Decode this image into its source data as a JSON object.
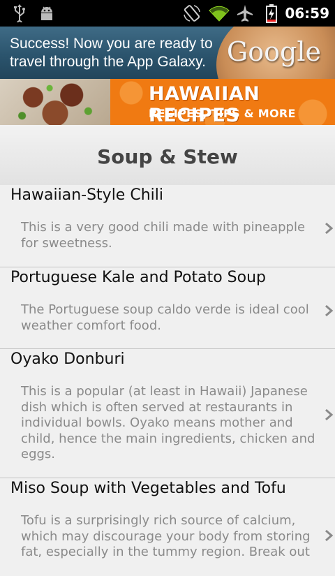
{
  "status_bar": {
    "time": "06:59",
    "icons": [
      "usb-icon",
      "android-debug-icon",
      "rotation-icon",
      "wifi-icon",
      "airplane-icon",
      "battery-charging-icon"
    ]
  },
  "ad_banner": {
    "text": "Success! Now you are ready to travel through the App Galaxy.",
    "brand": "Google"
  },
  "header_banner": {
    "title": "HAWAIIAN RECIPES",
    "subtitle": "RECIPES, TIPS & MORE"
  },
  "category": {
    "title": "Soup & Stew"
  },
  "recipes": [
    {
      "title": "Hawaiian-Style Chili",
      "description": "This is a very good chili made with pineapple for sweetness."
    },
    {
      "title": "Portuguese Kale and Potato Soup",
      "description": "The Portuguese soup caldo verde is ideal cool weather comfort food."
    },
    {
      "title": "Oyako Donburi",
      "description": "This is a popular (at least in Hawaii) Japanese dish which is often served at restaurants in individual bowls. Oyako means mother and child, hence the main ingredients, chicken and eggs."
    },
    {
      "title": "Miso Soup with Vegetables and Tofu",
      "description": "Tofu is a surprisingly rich source of calcium, which may discourage your body from storing fat, especially in the tummy region. Break out"
    }
  ],
  "colors": {
    "accent_orange": "#f07a12",
    "status_bar": "#000000",
    "list_background": "#f0f0f0"
  }
}
